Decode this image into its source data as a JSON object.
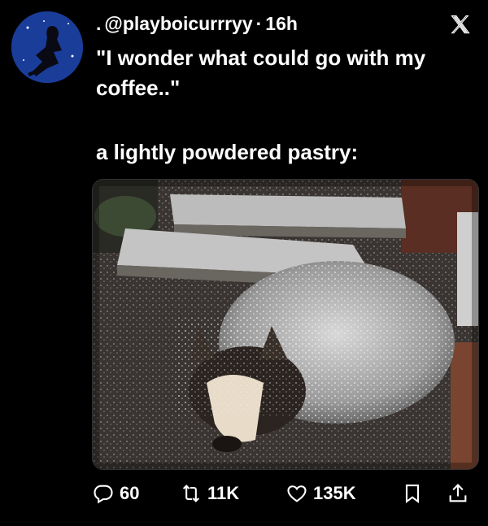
{
  "tweet": {
    "handle": "@playboicurrryy",
    "separator": "·",
    "time": "16h",
    "line1": "\"I wonder what could go with my coffee..\"",
    "line2": "a lightly powdered pastry:"
  },
  "actions": {
    "replies": "60",
    "retweets": "11K",
    "likes": "135K"
  },
  "icons": {
    "brand": "x-logo-icon",
    "reply": "reply-bubble-icon",
    "retweet": "retweet-arrows-icon",
    "like": "heart-icon",
    "bookmark": "bookmark-icon",
    "share": "share-icon"
  },
  "colors": {
    "background": "#000000",
    "text": "#ffffff",
    "avatar_bg": "#1c3f9c"
  }
}
